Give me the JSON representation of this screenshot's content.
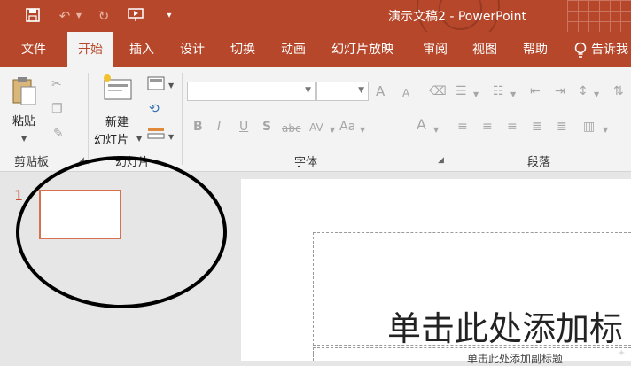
{
  "window": {
    "title": "演示文稿2 - PowerPoint",
    "brand_color": "#b7472a"
  },
  "qat": {
    "save_icon": "save-icon",
    "undo_icon": "undo-icon",
    "redo_icon": "redo-icon",
    "present_icon": "present-from-start-icon",
    "customize_icon": "customize-qat-icon"
  },
  "tabs": [
    {
      "label": "文件"
    },
    {
      "label": "开始",
      "active": true
    },
    {
      "label": "插入"
    },
    {
      "label": "设计"
    },
    {
      "label": "切换"
    },
    {
      "label": "动画"
    },
    {
      "label": "幻灯片放映"
    },
    {
      "label": "审阅"
    },
    {
      "label": "视图"
    },
    {
      "label": "帮助"
    },
    {
      "label": "告诉我"
    }
  ],
  "ribbon": {
    "clipboard": {
      "paste_label": "粘贴",
      "group_label": "剪贴板"
    },
    "slides": {
      "new_slide_line1": "新建",
      "new_slide_line2": "幻灯片",
      "group_label": "幻灯片"
    },
    "font": {
      "font_name": "",
      "font_size": "",
      "bold": "B",
      "italic": "I",
      "underline": "U",
      "shadow": "S",
      "strike": "abc",
      "spacing": "AV",
      "case": "Aa",
      "color": "A",
      "grow": "A",
      "shrink": "A",
      "group_label": "字体"
    },
    "paragraph": {
      "group_label": "段落"
    }
  },
  "thumbnails": {
    "slide_number": "1"
  },
  "slide": {
    "title_placeholder": "单击此处添加标",
    "subtitle_placeholder": "单击此处添加副标题"
  }
}
